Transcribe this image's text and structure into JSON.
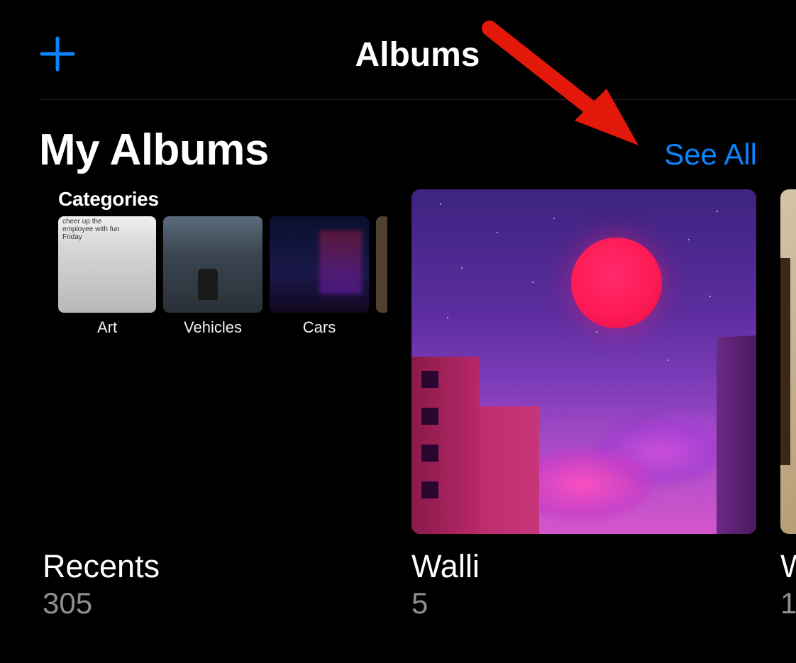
{
  "header": {
    "title": "Albums"
  },
  "section": {
    "title": "My Albums",
    "see_all": "See All"
  },
  "recents_cover": {
    "categories_label": "Categories",
    "tiles": [
      "Art",
      "Vehicles",
      "Cars"
    ],
    "art_caption": "cheer up the employee with fun Friday"
  },
  "albums": [
    {
      "name": "Recents",
      "count": "305"
    },
    {
      "name": "Walli",
      "count": "5"
    },
    {
      "name": "W",
      "count": "1"
    }
  ],
  "colors": {
    "accent": "#0a84ff",
    "annotation": "#e3170a"
  }
}
